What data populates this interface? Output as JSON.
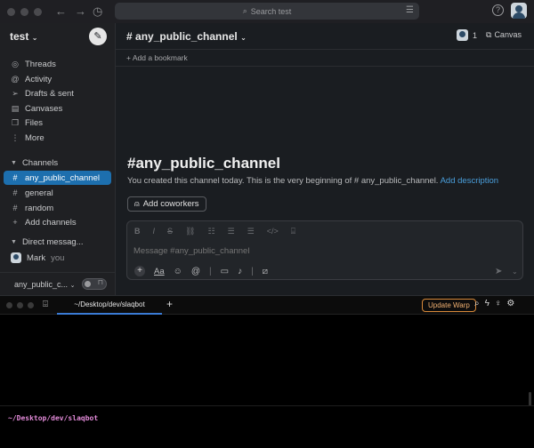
{
  "slack": {
    "search_placeholder": "Search test",
    "workspace_name": "test",
    "nav_items": [
      {
        "label": "Threads",
        "icon": "threads-icon",
        "glyph": "◎"
      },
      {
        "label": "Activity",
        "icon": "activity-icon",
        "glyph": "@"
      },
      {
        "label": "Drafts & sent",
        "icon": "send-icon",
        "glyph": "➢"
      },
      {
        "label": "Canvases",
        "icon": "canvas-icon",
        "glyph": "▤"
      },
      {
        "label": "Files",
        "icon": "files-icon",
        "glyph": "❒"
      },
      {
        "label": "More",
        "icon": "more-icon",
        "glyph": "⋮"
      }
    ],
    "channels_section": "Channels",
    "channels": [
      {
        "label": "any_public_channel",
        "active": true
      },
      {
        "label": "general",
        "active": false
      },
      {
        "label": "random",
        "active": false
      }
    ],
    "add_channels": "Add channels",
    "dm_section": "Direct messag...",
    "dm_user": "Mark",
    "dm_you": "you",
    "bottom_channel": "any_public_c...",
    "channel_title": "any_public_channel",
    "member_count": "1",
    "canvas_label": "Canvas",
    "bookmark_label": "Add a bookmark",
    "intro_title": "any_public_channel",
    "intro_text": "You created this channel today. This is the very beginning of # any_public_channel.",
    "add_description": "Add description",
    "add_coworkers": "Add coworkers",
    "message_placeholder": "Message #any_public_channel"
  },
  "warp": {
    "tab_title": "~/Desktop/dev/slaqbot",
    "update_label": "Update Warp",
    "prompt_path": "~/Desktop/dev/slaqbot"
  },
  "colors": {
    "accent": "#1d6fae",
    "link": "#4a9fdc",
    "warp_update": "#d98a3a",
    "warp_path": "#e28ad8"
  }
}
